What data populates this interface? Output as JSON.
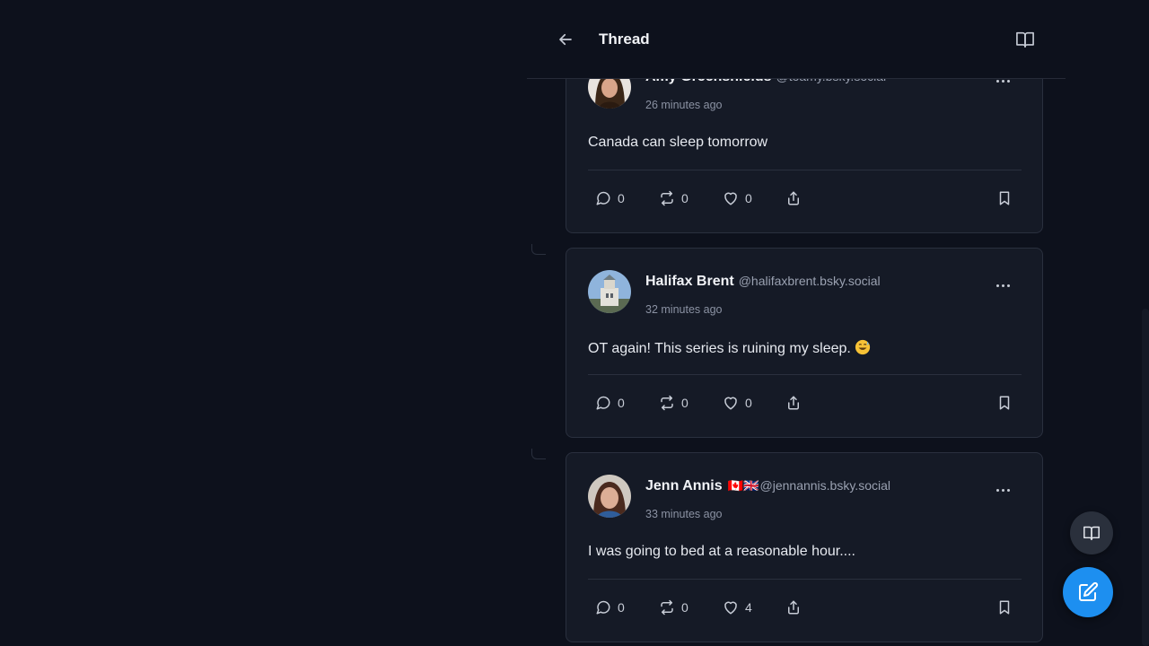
{
  "header": {
    "title": "Thread"
  },
  "posts": [
    {
      "display_name": "Amy Greenshields",
      "handle": "@toamy.bsky.social",
      "time": "26 minutes ago",
      "text": "Canada can sleep tomorrow",
      "replies": "0",
      "reposts": "0",
      "likes": "0"
    },
    {
      "display_name": "Halifax Brent",
      "handle": "@halifaxbrent.bsky.social",
      "time": "32 minutes ago",
      "text": "OT again! This series is ruining my sleep.",
      "emoji": "grinning-sweat-emoji",
      "replies": "0",
      "reposts": "0",
      "likes": "0"
    },
    {
      "display_name": "Jenn Annis",
      "flags": "🇨🇦🇬🇧",
      "handle": "@jennannis.bsky.social",
      "time": "33 minutes ago",
      "text": "I was going to bed at a reasonable hour....",
      "replies": "0",
      "reposts": "0",
      "likes": "4"
    }
  ],
  "colors": {
    "background": "#0d111c",
    "card": "#151a26",
    "accent": "#1d8ff0"
  },
  "icons": {
    "back": "arrow-left-icon",
    "reader": "book-open-icon",
    "reply": "chat-bubble-icon",
    "repost": "repost-icon",
    "like": "heart-icon",
    "share": "share-icon",
    "bookmark": "bookmark-icon",
    "more": "more-dots-icon",
    "compose": "compose-icon"
  }
}
